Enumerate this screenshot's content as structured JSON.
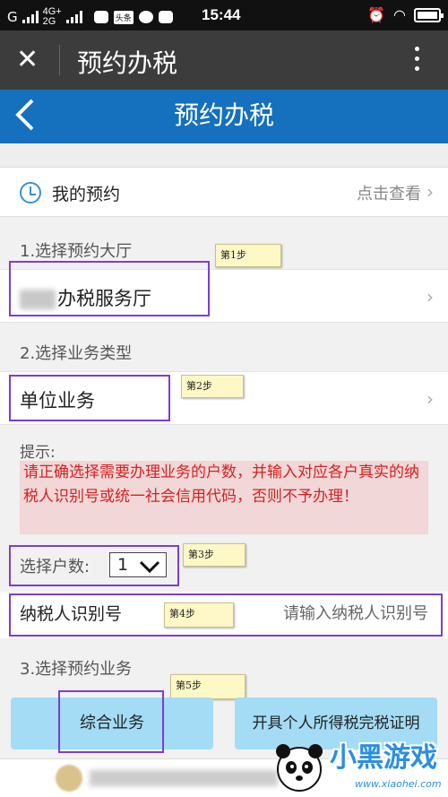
{
  "status_bar": {
    "carrier": "G",
    "network": "4G+",
    "network2": "2G",
    "toutiao_label": "头条",
    "time": "15:44"
  },
  "app_bar": {
    "title": "预约办税"
  },
  "header": {
    "title": "预约办税"
  },
  "my_appointment": {
    "label": "我的预约",
    "action": "点击查看"
  },
  "step1": {
    "section_label": "1.选择预约大厅",
    "hall_name": "办税服务厅",
    "note": "第1步"
  },
  "step2": {
    "section_label": "2.选择业务类型",
    "business_type": "单位业务",
    "note": "第2步"
  },
  "tip": {
    "label": "提示:",
    "text": "请正确选择需要办理业务的户数，并输入对应各户真实的纳税人识别号或统一社会信用代码，否则不予办理！"
  },
  "household": {
    "label": "选择户数:",
    "value": "1",
    "note": "第3步"
  },
  "taxpayer_id": {
    "label": "纳税人识别号",
    "placeholder": "请输入纳税人识别号",
    "note": "第4步"
  },
  "step3": {
    "section_label": "3.选择预约业务",
    "note": "第5步",
    "buttons": [
      "综合业务",
      "开具个人所得税完税证明"
    ]
  },
  "watermark": {
    "text": "小黑游戏",
    "url": "www.xiaohei.com"
  },
  "colors": {
    "header_blue": "#1570be",
    "annotation_purple": "#7a3ddb",
    "tip_red": "#d82020",
    "button_blue": "#a3dcf4"
  }
}
